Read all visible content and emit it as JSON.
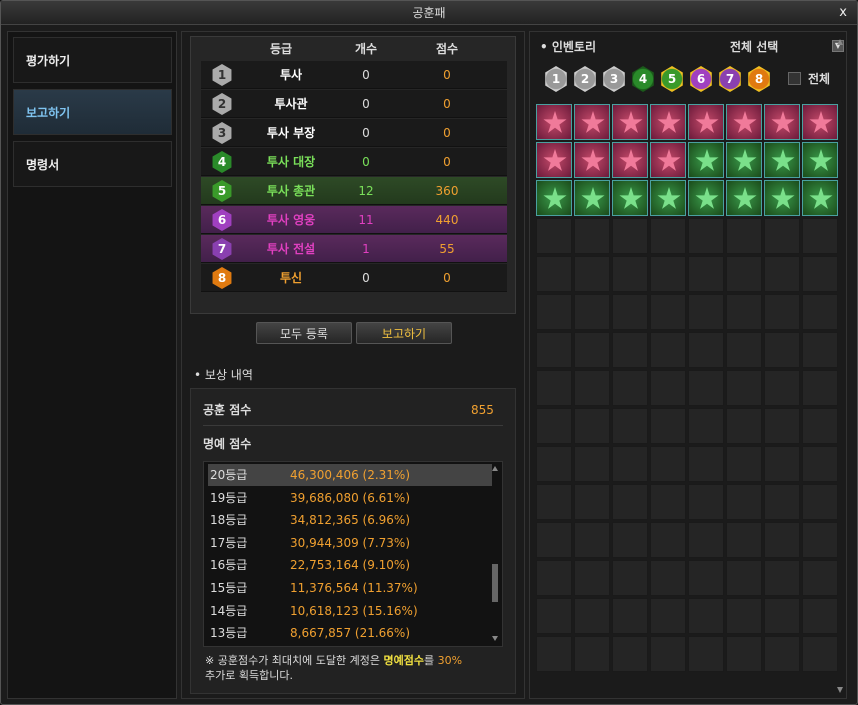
{
  "window": {
    "title": "공훈패",
    "close": "x"
  },
  "nav": {
    "items": [
      "평가하기",
      "보고하기",
      "명령서"
    ],
    "active": 1
  },
  "grades": {
    "headers": [
      "등급",
      "개수",
      "점수"
    ],
    "rows": [
      {
        "num": "1",
        "name": "투사",
        "count": "0",
        "score": "0",
        "style": "plain",
        "hex": "h1",
        "nameColor": "#ffffff",
        "countColor": "#dddddd",
        "scoreColor": "#f0a030"
      },
      {
        "num": "2",
        "name": "투사관",
        "count": "0",
        "score": "0",
        "style": "plain",
        "hex": "h1",
        "nameColor": "#ffffff",
        "countColor": "#dddddd",
        "scoreColor": "#f0a030"
      },
      {
        "num": "3",
        "name": "투사 부장",
        "count": "0",
        "score": "0",
        "style": "plain",
        "hex": "h1",
        "nameColor": "#ffffff",
        "countColor": "#dddddd",
        "scoreColor": "#f0a030"
      },
      {
        "num": "4",
        "name": "투사 대장",
        "count": "0",
        "score": "0",
        "style": "plain",
        "hex": "h4",
        "nameColor": "#7ae05a",
        "countColor": "#7ae05a",
        "scoreColor": "#f0a030"
      },
      {
        "num": "5",
        "name": "투사 총관",
        "count": "12",
        "score": "360",
        "style": "green",
        "hex": "h5",
        "nameColor": "#7ae05a",
        "countColor": "#7ae05a",
        "scoreColor": "#f0a030"
      },
      {
        "num": "6",
        "name": "투사 영웅",
        "count": "11",
        "score": "440",
        "style": "purple",
        "hex": "h6",
        "nameColor": "#e040c0",
        "countColor": "#e040c0",
        "scoreColor": "#f0a030"
      },
      {
        "num": "7",
        "name": "투사 전설",
        "count": "1",
        "score": "55",
        "style": "purple",
        "hex": "h7",
        "nameColor": "#e040c0",
        "countColor": "#e040c0",
        "scoreColor": "#f0a030"
      },
      {
        "num": "8",
        "name": "투신",
        "count": "0",
        "score": "0",
        "style": "plain",
        "hex": "h8",
        "nameColor": "#f0a030",
        "countColor": "#dddddd",
        "scoreColor": "#f0a030"
      }
    ]
  },
  "buttons": {
    "register_all": "모두 등록",
    "report": "보고하기"
  },
  "reward": {
    "title": "보상 내역",
    "merit_label": "공훈 점수",
    "merit_value": "855",
    "honor_label": "명예 점수",
    "list": [
      {
        "rank": "20등급",
        "value": "46,300,406 (2.31%)"
      },
      {
        "rank": "19등급",
        "value": "39,686,080 (6.61%)"
      },
      {
        "rank": "18등급",
        "value": "34,812,365 (6.96%)"
      },
      {
        "rank": "17등급",
        "value": "30,944,309 (7.73%)"
      },
      {
        "rank": "16등급",
        "value": "22,753,164 (9.10%)"
      },
      {
        "rank": "15등급",
        "value": "11,376,564 (11.37%)"
      },
      {
        "rank": "14등급",
        "value": "10,618,123 (15.16%)"
      },
      {
        "rank": "13등급",
        "value": "8,667,857 (21.66%)"
      }
    ],
    "note_a": "※ 공훈점수가 최대치에 도달한 계정은 ",
    "note_hl": "명예점수",
    "note_b": "를 ",
    "note_pct": "30%",
    "note_c": "추가로 획득합니다."
  },
  "inventory": {
    "title": "인벤토리",
    "select_all": "전체 선택",
    "filter_all": "전체",
    "filters": [
      "1",
      "2",
      "3",
      "4",
      "5",
      "6",
      "7",
      "8"
    ],
    "slots": [
      "pink",
      "pink",
      "pink",
      "pink",
      "pink",
      "pink",
      "pink",
      "pink",
      "pink",
      "pink",
      "pink",
      "pink",
      "green",
      "green",
      "green",
      "green",
      "green",
      "green",
      "green",
      "green",
      "green",
      "green",
      "green",
      "green"
    ]
  }
}
